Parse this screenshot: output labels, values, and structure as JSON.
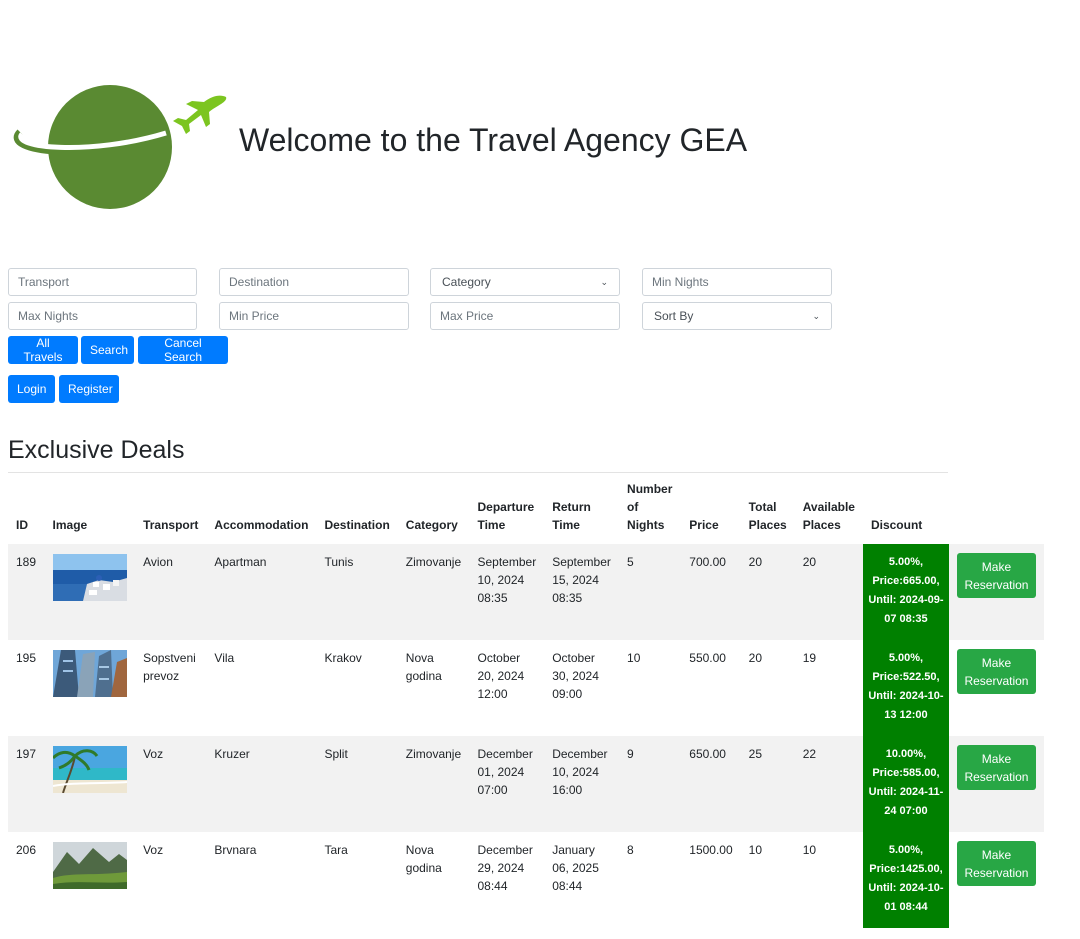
{
  "header": {
    "title": "Welcome to the Travel Agency GEA"
  },
  "search": {
    "transport_placeholder": "Transport",
    "destination_placeholder": "Destination",
    "category_selected": "Category",
    "min_nights_placeholder": "Min Nights",
    "max_nights_placeholder": "Max Nights",
    "min_price_placeholder": "Min Price",
    "max_price_placeholder": "Max Price",
    "sort_selected": "Sort By",
    "all_travels_label": "All Travels",
    "search_label": "Search",
    "cancel_label": "Cancel Search"
  },
  "auth": {
    "login_label": "Login",
    "register_label": "Register"
  },
  "deals": {
    "title": "Exclusive Deals",
    "columns": {
      "id": "ID",
      "image": "Image",
      "transport": "Transport",
      "accommodation": "Accommodation",
      "destination": "Destination",
      "category": "Category",
      "departure": "Departure Time",
      "return": "Return Time",
      "nights": "Number of Nights",
      "price": "Price",
      "total": "Total Places",
      "available": "Available Places",
      "discount": "Discount"
    },
    "reserve_label": "Make Reservation",
    "rows": [
      {
        "id": "189",
        "image": "santorini-photo",
        "transport": "Avion",
        "accommodation": "Apartman",
        "destination": "Tunis",
        "category": "Zimovanje",
        "departure": "September 10, 2024 08:35",
        "return": "September 15, 2024 08:35",
        "nights": "5",
        "price": "700.00",
        "total": "20",
        "available": "20",
        "discount": "5.00%, Price:665.00, Until: 2024-09-07 08:35"
      },
      {
        "id": "195",
        "image": "city-towers-photo",
        "transport": "Sopstveni prevoz",
        "accommodation": "Vila",
        "destination": "Krakov",
        "category": "Nova godina",
        "departure": "October 20, 2024 12:00",
        "return": "October 30, 2024 09:00",
        "nights": "10",
        "price": "550.00",
        "total": "20",
        "available": "19",
        "discount": "5.00%, Price:522.50, Until: 2024-10-13 12:00"
      },
      {
        "id": "197",
        "image": "palm-beach-photo",
        "transport": "Voz",
        "accommodation": "Kruzer",
        "destination": "Split",
        "category": "Zimovanje",
        "departure": "December 01, 2024 07:00",
        "return": "December 10, 2024 16:00",
        "nights": "9",
        "price": "650.00",
        "total": "25",
        "available": "22",
        "discount": "10.00%, Price:585.00, Until: 2024-11-24 07:00"
      },
      {
        "id": "206",
        "image": "mountain-valley-photo",
        "transport": "Voz",
        "accommodation": "Brvnara",
        "destination": "Tara",
        "category": "Nova godina",
        "departure": "December 29, 2024 08:44",
        "return": "January 06, 2025 08:44",
        "nights": "8",
        "price": "1500.00",
        "total": "10",
        "available": "10",
        "discount": "5.00%, Price:1425.00, Until: 2024-10-01 08:44"
      }
    ]
  },
  "colors": {
    "primary": "#007bff",
    "reserve": "#28a745",
    "discount_bg": "#008000",
    "logo_green": "#5a8a32",
    "plane_green": "#7cc520"
  }
}
